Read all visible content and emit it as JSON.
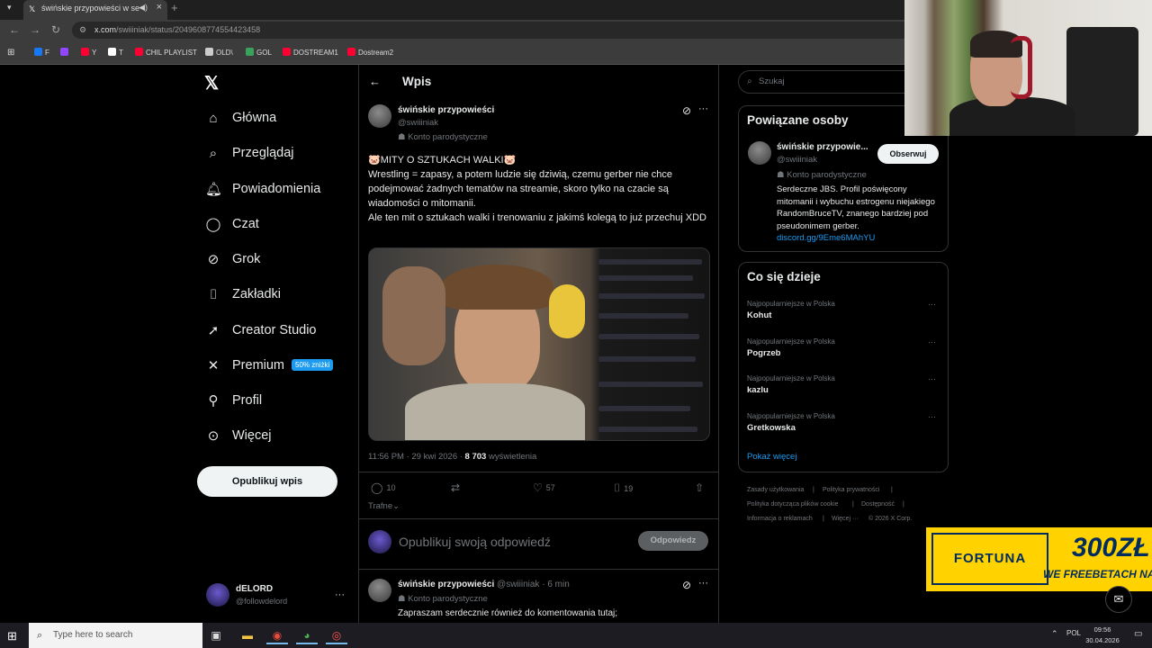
{
  "browser": {
    "tab_title": "świńskie przypowieści w se",
    "url_domain": "x.com",
    "url_path": "/swiiiniak/status/2049608774554423458",
    "bookmarks": [
      {
        "label": "F",
        "color": "#1877f2"
      },
      {
        "label": "",
        "color": "#9146ff"
      },
      {
        "label": "Y",
        "color": "#ff0033"
      },
      {
        "label": "T",
        "color": "#ffffff"
      },
      {
        "label": "CHIL PLAYLIST",
        "color": "#ff0033"
      },
      {
        "label": "OLD\\",
        "color": "#cccccc"
      },
      {
        "label": "GOL",
        "color": "#3aa35b"
      },
      {
        "label": "DOSTREAM1",
        "color": "#ff0033"
      },
      {
        "label": "Dostream2",
        "color": "#ff0033"
      }
    ]
  },
  "nav": {
    "items": [
      {
        "label": "Główna",
        "icon": "home-icon",
        "glyph": "⌂"
      },
      {
        "label": "Przeglądaj",
        "icon": "search-icon",
        "glyph": "⌕"
      },
      {
        "label": "Powiadomienia",
        "icon": "bell-icon",
        "glyph": "♫"
      },
      {
        "label": "Czat",
        "icon": "chat-icon",
        "glyph": "◯"
      },
      {
        "label": "Grok",
        "icon": "grok-icon",
        "glyph": "⊘"
      },
      {
        "label": "Zakładki",
        "icon": "bookmark-icon",
        "glyph": "⌷"
      },
      {
        "label": "Creator Studio",
        "icon": "rocket-icon",
        "glyph": "➚"
      },
      {
        "label": "Premium",
        "icon": "x-premium-icon",
        "glyph": "✕"
      },
      {
        "label": "Profil",
        "icon": "profile-icon",
        "glyph": "⚲"
      },
      {
        "label": "Więcej",
        "icon": "more-circle-icon",
        "glyph": "⊙"
      }
    ],
    "premium_badge": "50% zniżki",
    "publish_label": "Opublikuj wpis",
    "me": {
      "name": "dELORD",
      "handle": "@followdelord"
    }
  },
  "main": {
    "header_title": "Wpis",
    "tweet": {
      "author_name": "świńskie przypowieści",
      "author_handle": "@swiiiniak",
      "parody_label": "Konto parodystyczne",
      "text_lines": [
        "🐷MITY O SZTUKACH WALKI🐷",
        "Wrestling = zapasy, a potem ludzie się dziwią, czemu gerber nie chce podejmować żadnych tematów na streamie, skoro tylko na czacie są wiadomości o mitomanii.",
        "Ale ten mit o sztukach walki i trenowaniu z jakimś kolegą to już przechuj XDD"
      ],
      "time": "11:56 PM · 29 kwi 2026 ·",
      "views_count": "8 703",
      "views_label": "wyświetlenia",
      "replies": "10",
      "retweets": "",
      "likes": "57",
      "bookmarks": "19"
    },
    "sort_label": "Trafne",
    "reply_placeholder": "Opublikuj swoją odpowiedź",
    "reply_button": "Odpowiedz",
    "reply": {
      "author_name": "świńskie przypowieści",
      "author_handle": "@swiiiniak",
      "age": "· 6 min",
      "parody_label": "Konto parodystyczne",
      "text": "Zapraszam serdecznie również do komentowania tutaj;"
    }
  },
  "sidebar": {
    "search_placeholder": "Szukaj",
    "related_title": "Powiązane osoby",
    "related": {
      "name": "świńskie przypowie...",
      "handle": "@swiiiniak",
      "parody_label": "Konto parodystyczne",
      "follow_label": "Obserwuj",
      "bio": "Serdeczne JBS. Profil poświęcony mitomanii i wybuchu estrogenu niejakiego RandomBruceTV, znanego bardziej pod pseudonimem gerber.",
      "link": "discord.gg/9Eme6MAhYU"
    },
    "trends_title": "Co się dzieje",
    "trends": [
      {
        "category": "Najpopularniejsze w Polska",
        "name": "Kohut"
      },
      {
        "category": "Najpopularniejsze w Polska",
        "name": "Pogrzeb"
      },
      {
        "category": "Najpopularniejsze w Polska",
        "name": "kazlu"
      },
      {
        "category": "Najpopularniejsze w Polska",
        "name": "Gretkowska"
      }
    ],
    "show_more": "Pokaż więcej",
    "footer": [
      "Zasady użytkowania",
      "|",
      "Polityka prywatności",
      "|",
      "Polityka dotycząca plików cookie",
      "|",
      "Dostępność",
      "|",
      "Informacja o reklamach",
      "|",
      "Więcej ···",
      "© 2026 X Corp."
    ]
  },
  "ad": {
    "brand": "FORTUNA",
    "amount": "300ZŁ",
    "text": "WE FREEBETACH NA ST"
  },
  "taskbar": {
    "search_placeholder": "Type here to search",
    "language": "POL",
    "time": "09:56",
    "date": "30.04.2026"
  },
  "colors": {
    "accent": "#1d9bf0",
    "background": "#000000",
    "border": "#2f3336",
    "muted": "#71767b"
  }
}
